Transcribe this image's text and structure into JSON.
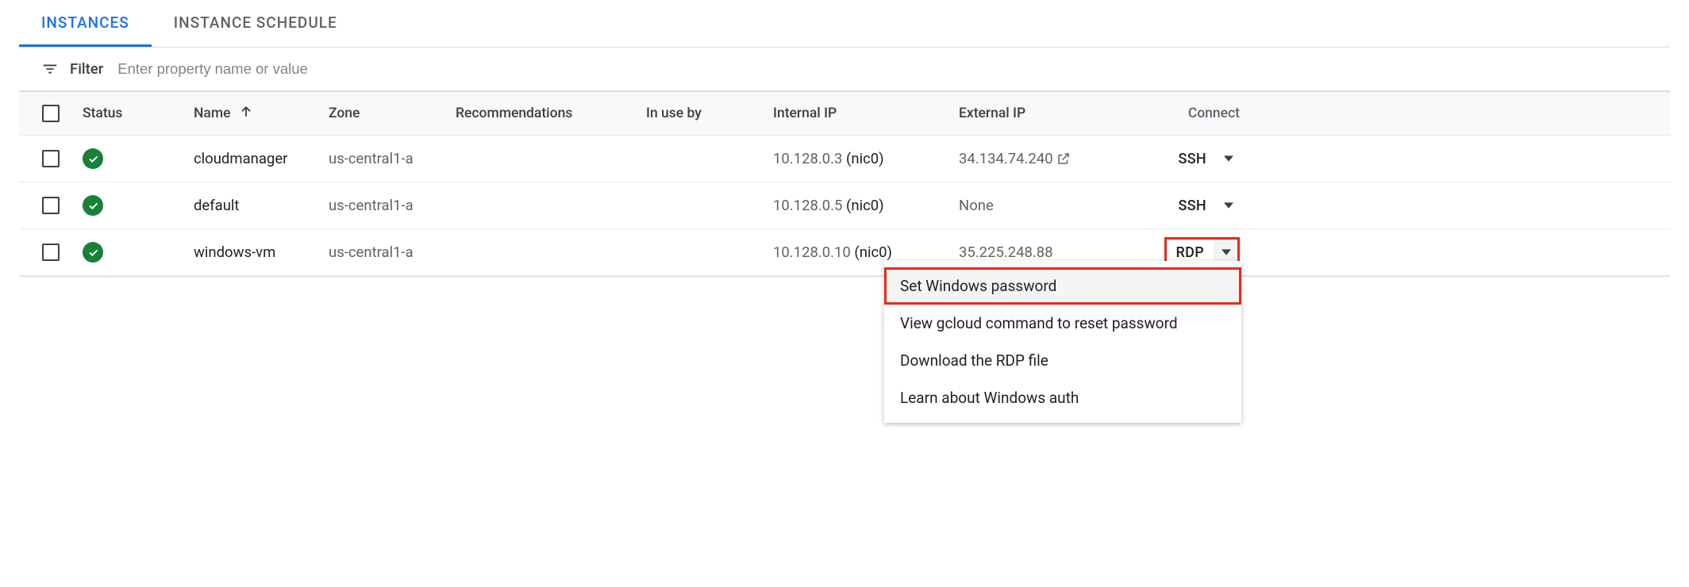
{
  "tabs": {
    "instances": "INSTANCES",
    "schedule": "INSTANCE SCHEDULE"
  },
  "filter": {
    "label": "Filter",
    "placeholder": "Enter property name or value"
  },
  "columns": {
    "status": "Status",
    "name": "Name",
    "zone": "Zone",
    "recommendations": "Recommendations",
    "in_use_by": "In use by",
    "internal_ip": "Internal IP",
    "external_ip": "External IP",
    "connect": "Connect"
  },
  "rows": [
    {
      "name": "cloudmanager",
      "zone": "us-central1-a",
      "recommendations": "",
      "in_use_by": "",
      "internal_ip": "10.128.0.3",
      "internal_nic": "(nic0)",
      "external_ip": "34.134.74.240",
      "external_launch": true,
      "connect": "SSH"
    },
    {
      "name": "default",
      "zone": "us-central1-a",
      "recommendations": "",
      "in_use_by": "",
      "internal_ip": "10.128.0.5",
      "internal_nic": "(nic0)",
      "external_ip": "None",
      "external_launch": false,
      "connect": "SSH"
    },
    {
      "name": "windows-vm",
      "zone": "us-central1-a",
      "recommendations": "",
      "in_use_by": "",
      "internal_ip": "10.128.0.10",
      "internal_nic": "(nic0)",
      "external_ip": "35.225.248.88",
      "external_launch": false,
      "connect": "RDP",
      "connect_highlight": true
    }
  ],
  "menu": {
    "set_password": "Set Windows password",
    "view_gcloud": "View gcloud command to reset password",
    "download_rdp": "Download the RDP file",
    "learn_auth": "Learn about Windows auth"
  }
}
